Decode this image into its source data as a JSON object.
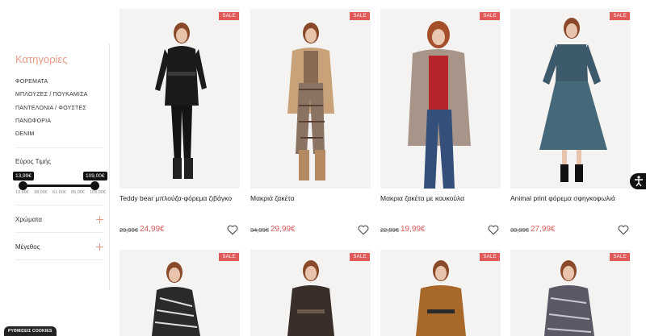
{
  "sidebar": {
    "categories_title": "Κατηγορίες",
    "categories": [
      "ΦΟΡΕΜΑΤΑ",
      "ΜΠΛΟΥΖΕΣ / ΠΟΥΚΑΜΙΣΑ",
      "ΠΑΝΤΕΛΟΝΙΑ / ΦΟΥΣΤΕΣ",
      "ΠΑΝΩΦΟΡΙΑ",
      "DENIM"
    ],
    "price_title": "Εύρος Τιμής",
    "price_min": "13,99€",
    "price_max": "109,00€",
    "price_ticks": [
      "13,99€",
      "38,00€",
      "61,00€",
      "85,00€",
      "109,00€"
    ],
    "colors_label": "Χρώματα",
    "size_label": "Μέγεθος"
  },
  "products": [
    {
      "name": "Teddy bear μπλούζα-φόρεμα ζιβάγκο",
      "old_price": "29,99€",
      "new_price": "24,99€",
      "badge": "SALE"
    },
    {
      "name": "Μακριά ζακέτα",
      "old_price": "34,99€",
      "new_price": "29,99€",
      "badge": "SALE"
    },
    {
      "name": "Μακρια ζακέτα με κουκούλα",
      "old_price": "22,99€",
      "new_price": "19,99€",
      "badge": "SALE"
    },
    {
      "name": "Animal print φόρεμα σφηγκοφωλιά",
      "old_price": "39,99€",
      "new_price": "27,99€",
      "badge": "SALE"
    }
  ],
  "products_row2": [
    {
      "badge": "SALE"
    },
    {
      "badge": "SALE"
    },
    {
      "badge": "SALE"
    },
    {
      "badge": "SALE"
    }
  ],
  "cookie_button": "ΡΥΘΜΙΣΕΙΣ COOKIES",
  "icons": {
    "favorite": "heart-icon",
    "accessibility": "accessibility-icon",
    "expand": "plus-icon"
  },
  "colors": {
    "accent": "#e79b86",
    "sale": "#e05a5a",
    "dark": "#111111"
  }
}
